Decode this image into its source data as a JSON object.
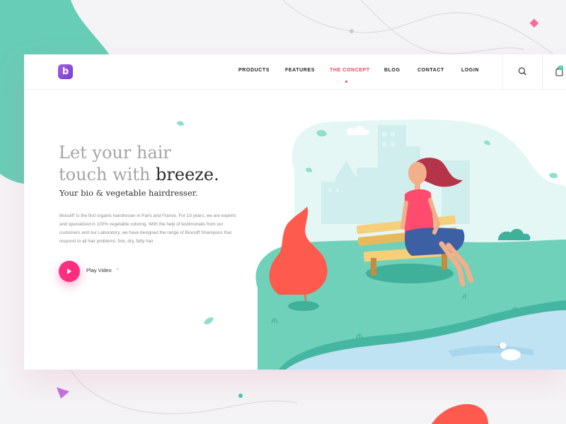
{
  "brand": {
    "logo_letter": "b",
    "accent_color": "#7a3fcf"
  },
  "nav": {
    "items": [
      {
        "label": "PRODUCTS",
        "active": false
      },
      {
        "label": "FEATURES",
        "active": false
      },
      {
        "label": "THE CONCEPT",
        "active": true
      },
      {
        "label": "BLOG",
        "active": false
      },
      {
        "label": "CONTACT",
        "active": false
      },
      {
        "label": "LOGIN",
        "active": false
      }
    ],
    "active_color": "#ff3d57",
    "search_icon": "search-icon",
    "cart_icon": "shopping-bag-icon",
    "cart_count": "0"
  },
  "hero": {
    "title_line1": "Let your hair",
    "title_line2_light": "touch with ",
    "title_line2_strong": "breeze.",
    "subtitle": "Your bio & vegetable hairdresser.",
    "body": "Biocoiff 'is the first organic hairdresser in Paris and France. For 10 years, we are experts and specialized in 100% vegetable coloring. With the help of testimonials from our customers and our Laboratory, we have designed the range of Biocoiff Shampoos that respond to all hair problems: fine, dry, fatty hair .",
    "play_label": "Play Video",
    "play_arrows": "››",
    "play_color": "#ff2d7e"
  }
}
